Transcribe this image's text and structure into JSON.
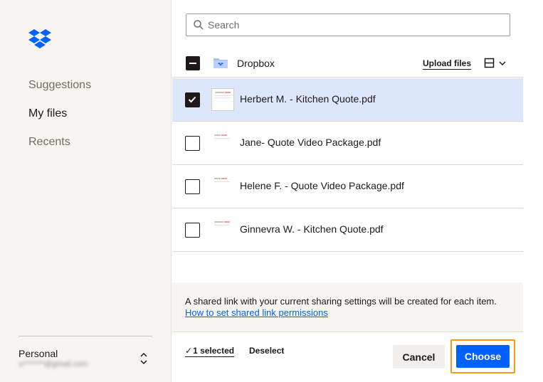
{
  "colors": {
    "sidebar_bg": "#f7f5f2",
    "accent_blue": "#0061fe",
    "selected_row": "#dde7fb",
    "highlight_outline": "#f29d13",
    "text": "#1e1919",
    "muted_text": "#736c64"
  },
  "sidebar": {
    "logo_icon": "dropbox-logo-icon",
    "nav": [
      {
        "label": "Suggestions",
        "active": false
      },
      {
        "label": "My files",
        "active": true
      },
      {
        "label": "Recents",
        "active": false
      }
    ],
    "account": {
      "name": "Personal",
      "email": "u*******@gmail.com",
      "switch_icon": "chevron-up-down-icon"
    }
  },
  "search": {
    "placeholder": "Search",
    "value": "",
    "icon": "search-icon"
  },
  "folder": {
    "name": "Dropbox",
    "upload_label": "Upload files",
    "view_icon": "grid-view-icon"
  },
  "files": [
    {
      "name": "Herbert M. - Kitchen Quote.pdf",
      "selected": true
    },
    {
      "name": "Jane- Quote Video Package.pdf",
      "selected": false
    },
    {
      "name": "Helene F. - Quote Video Package.pdf",
      "selected": false
    },
    {
      "name": "Ginnevra W. - Kitchen Quote.pdf",
      "selected": false
    }
  ],
  "info": {
    "text": "A shared link with your current sharing settings will be created for each item.",
    "link_text": "How to set shared link permissions"
  },
  "footer": {
    "selected_label": "1 selected",
    "deselect_label": "Deselect",
    "cancel_label": "Cancel",
    "choose_label": "Choose"
  }
}
